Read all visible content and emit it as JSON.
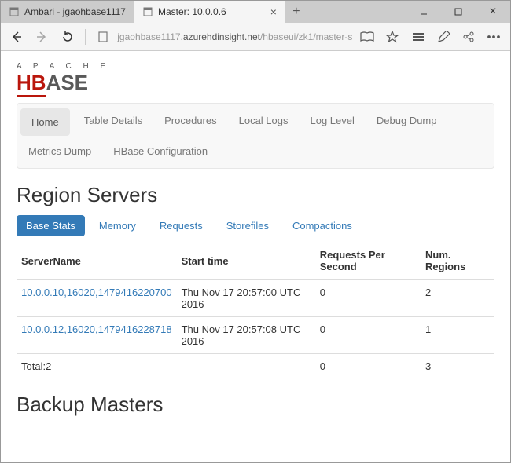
{
  "browser": {
    "tabs": [
      {
        "title": "Ambari - jgaohbase1117",
        "active": false
      },
      {
        "title": "Master: 10.0.0.6",
        "active": true
      }
    ],
    "url_prefix": "jgaohbase1117.",
    "url_domain": "azurehdinsight.net",
    "url_suffix": "/hbaseui/zk1/master-s"
  },
  "logo": {
    "apache": "A P A C H E",
    "word1": "HB",
    "word2": "ASE"
  },
  "nav": {
    "row1": [
      "Home",
      "Table Details",
      "Procedures",
      "Local Logs",
      "Log Level",
      "Debug Dump"
    ],
    "row2": [
      "Metrics Dump",
      "HBase Configuration"
    ],
    "active": "Home"
  },
  "section1": {
    "title": "Region Servers",
    "tabs": [
      "Base Stats",
      "Memory",
      "Requests",
      "Storefiles",
      "Compactions"
    ],
    "active_tab": "Base Stats",
    "columns": [
      "ServerName",
      "Start time",
      "Requests Per Second",
      "Num. Regions"
    ],
    "rows": [
      {
        "server": "10.0.0.10,16020,1479416220700",
        "start": "Thu Nov 17 20:57:00 UTC 2016",
        "rps": "0",
        "regions": "2"
      },
      {
        "server": "10.0.0.12,16020,1479416228718",
        "start": "Thu Nov 17 20:57:08 UTC 2016",
        "rps": "0",
        "regions": "1"
      }
    ],
    "total": {
      "label": "Total:2",
      "rps": "0",
      "regions": "3"
    }
  },
  "section2": {
    "title": "Backup Masters"
  }
}
